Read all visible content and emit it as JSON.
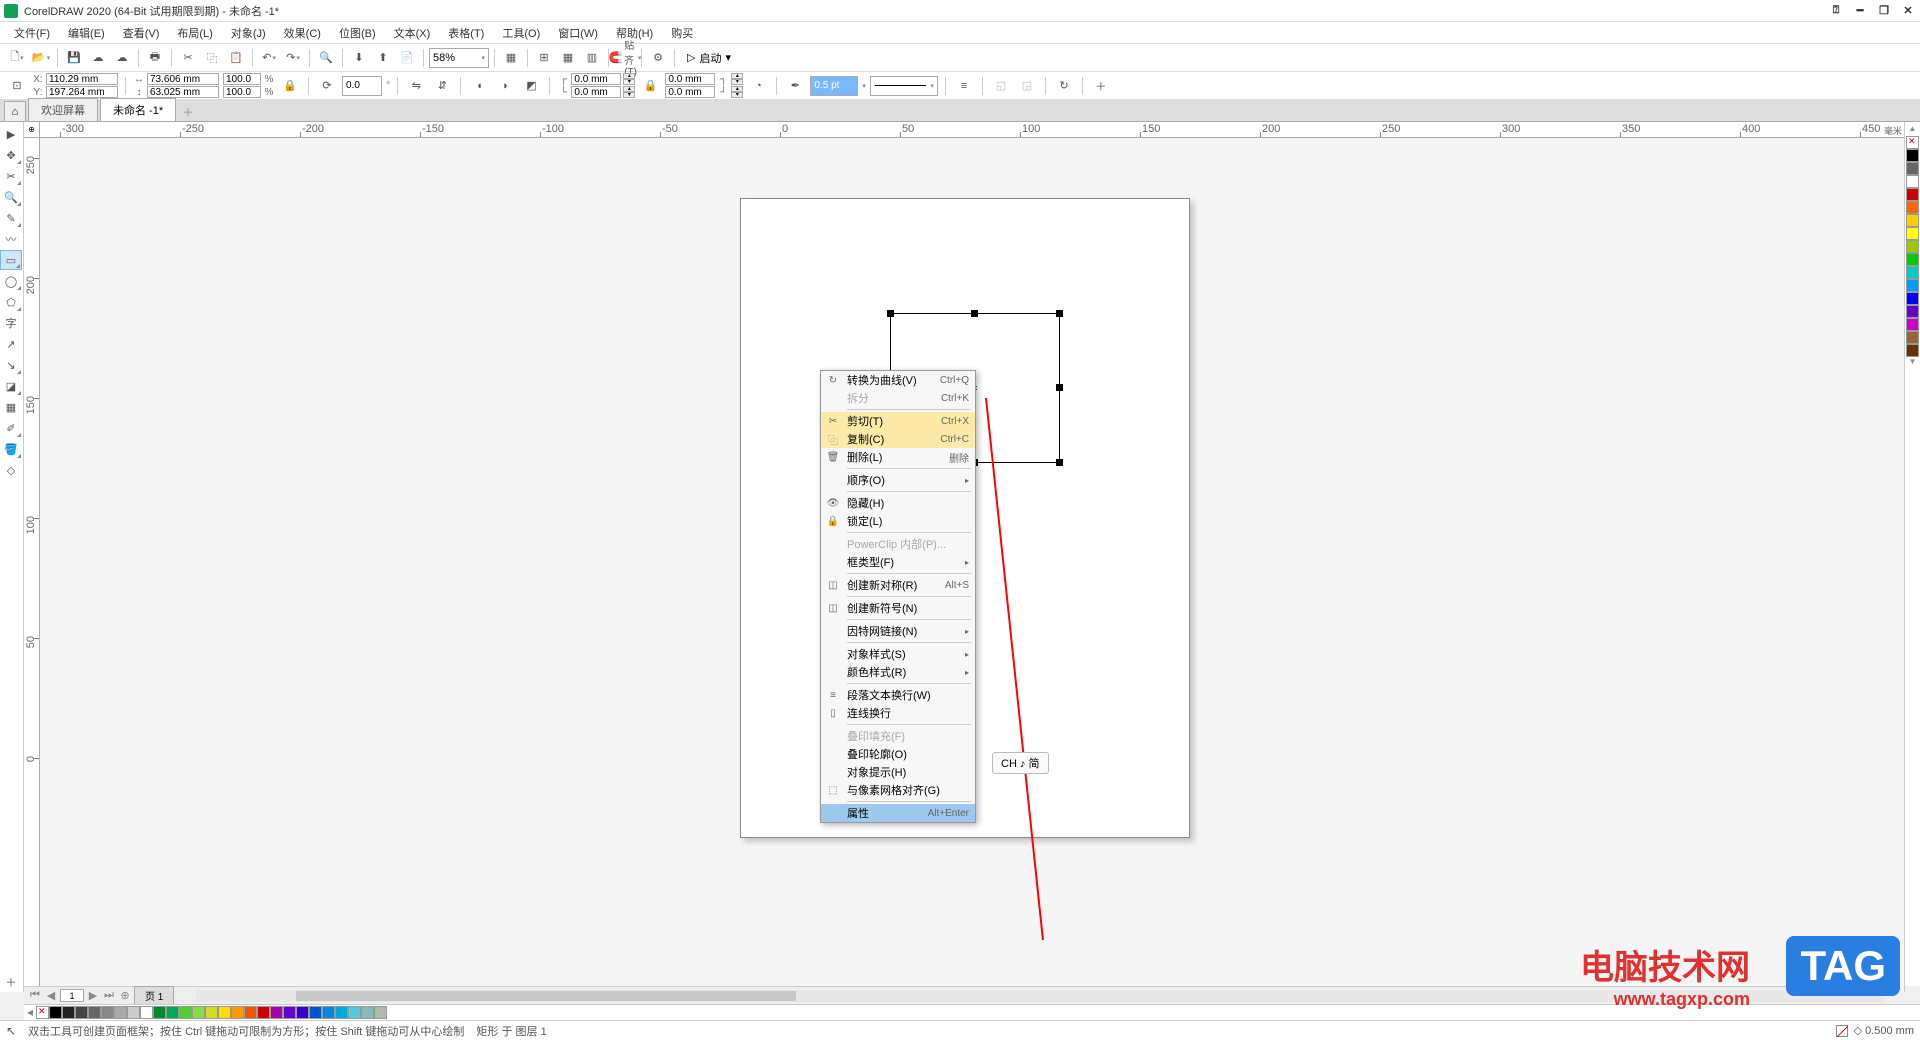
{
  "title": "CorelDRAW 2020 (64-Bit 试用期限到期) - 未命名 -1*",
  "menus": [
    "文件(F)",
    "编辑(E)",
    "查看(V)",
    "布局(L)",
    "对象(J)",
    "效果(C)",
    "位图(B)",
    "文本(X)",
    "表格(T)",
    "工具(O)",
    "窗口(W)",
    "帮助(H)",
    "购买"
  ],
  "toolbar1": {
    "zoom": "58%",
    "snap": "贴齐(T)",
    "launch": "启动"
  },
  "propbar": {
    "x": "110.29 mm",
    "y": "197.264 mm",
    "w": "73.606 mm",
    "h": "63.025 mm",
    "sx": "100.0",
    "sy": "100.0",
    "pct": "%",
    "angle": "0.0",
    "corner1": "0.0 mm",
    "corner2": "0.0 mm",
    "corner3": "0.0 mm",
    "corner4": "0.0 mm",
    "outline": "0.5 pt"
  },
  "tabs": {
    "welcome": "欢迎屏幕",
    "doc": "未命名 -1*"
  },
  "ruler_h": [
    "-300",
    "-250",
    "-200",
    "-150",
    "-100",
    "-50",
    "0",
    "50",
    "100",
    "150",
    "200",
    "250",
    "300",
    "350",
    "400",
    "450"
  ],
  "ruler_v": [
    "250",
    "200",
    "150",
    "100",
    "50",
    "0"
  ],
  "ruler_unit": "毫米",
  "context_menu": [
    {
      "icon": "↻",
      "label": "转换为曲线(V)",
      "shortcut": "Ctrl+Q",
      "t": "item"
    },
    {
      "icon": "",
      "label": "拆分",
      "shortcut": "Ctrl+K",
      "t": "disabled"
    },
    {
      "t": "sep"
    },
    {
      "icon": "✂",
      "label": "剪切(T)",
      "shortcut": "Ctrl+X",
      "t": "hl"
    },
    {
      "icon": "⿻",
      "label": "复制(C)",
      "shortcut": "Ctrl+C",
      "t": "hl"
    },
    {
      "icon": "🗑",
      "label": "删除(L)",
      "shortcut": "删除",
      "t": "item"
    },
    {
      "t": "sep"
    },
    {
      "icon": "",
      "label": "顺序(O)",
      "arrow": "▸",
      "t": "item"
    },
    {
      "t": "sep"
    },
    {
      "icon": "👁",
      "label": "隐藏(H)",
      "t": "item"
    },
    {
      "icon": "🔒",
      "label": "锁定(L)",
      "t": "item"
    },
    {
      "t": "sep"
    },
    {
      "icon": "",
      "label": "PowerClip 内部(P)...",
      "t": "disabled"
    },
    {
      "icon": "",
      "label": "框类型(F)",
      "arrow": "▸",
      "t": "item"
    },
    {
      "t": "sep"
    },
    {
      "icon": "◫",
      "label": "创建新对称(R)",
      "shortcut": "Alt+S",
      "t": "item"
    },
    {
      "t": "sep"
    },
    {
      "icon": "◫",
      "label": "创建新符号(N)",
      "t": "item"
    },
    {
      "t": "sep"
    },
    {
      "icon": "",
      "label": "因特网链接(N)",
      "arrow": "▸",
      "t": "item"
    },
    {
      "t": "sep"
    },
    {
      "icon": "",
      "label": "对象样式(S)",
      "arrow": "▸",
      "t": "item"
    },
    {
      "icon": "",
      "label": "颜色样式(R)",
      "arrow": "▸",
      "t": "item"
    },
    {
      "t": "sep"
    },
    {
      "icon": "≡",
      "label": "段落文本换行(W)",
      "t": "item"
    },
    {
      "icon": "▯",
      "label": "连线换行",
      "t": "item"
    },
    {
      "t": "sep"
    },
    {
      "icon": "",
      "label": "叠印填充(F)",
      "t": "disabled"
    },
    {
      "icon": "",
      "label": "叠印轮廓(O)",
      "t": "item"
    },
    {
      "icon": "",
      "label": "对象提示(H)",
      "t": "item"
    },
    {
      "icon": "⬚",
      "label": "与像素网格对齐(G)",
      "t": "item"
    },
    {
      "t": "sep"
    },
    {
      "icon": "",
      "label": "属性",
      "shortcut": "Alt+Enter",
      "t": "sel"
    }
  ],
  "ime": "CH ♪ 简",
  "pagetabs": {
    "page_no": "1",
    "page_label": "页 1"
  },
  "palette_colors": [
    "#000",
    "#222",
    "#444",
    "#666",
    "#888",
    "#aaa",
    "#ccc",
    "#fff",
    "#083",
    "#0a5",
    "#5c3",
    "#8d4",
    "#cd2",
    "#fd0",
    "#f90",
    "#e50",
    "#c00",
    "#a0a",
    "#60c",
    "#30c",
    "#05c",
    "#08d",
    "#0ad",
    "#5cd",
    "#8bb",
    "#aba"
  ],
  "colorbar_colors": [
    "#000",
    "#666",
    "#fff",
    "#c00",
    "#f60",
    "#fc0",
    "#ff0",
    "#9c0",
    "#0c0",
    "#0cc",
    "#09f",
    "#00f",
    "#60c",
    "#c0c",
    "#963",
    "#630"
  ],
  "status": {
    "hint": "双击工具可创建页面框架；按住 Ctrl 键拖动可限制为方形；按住 Shift 键拖动可从中心绘制",
    "obj": "矩形 于 图层 1",
    "right": "0.500 mm"
  },
  "watermark": {
    "l1": "电脑技术网",
    "l2": "www.tagxp.com",
    "tag": "TAG"
  }
}
